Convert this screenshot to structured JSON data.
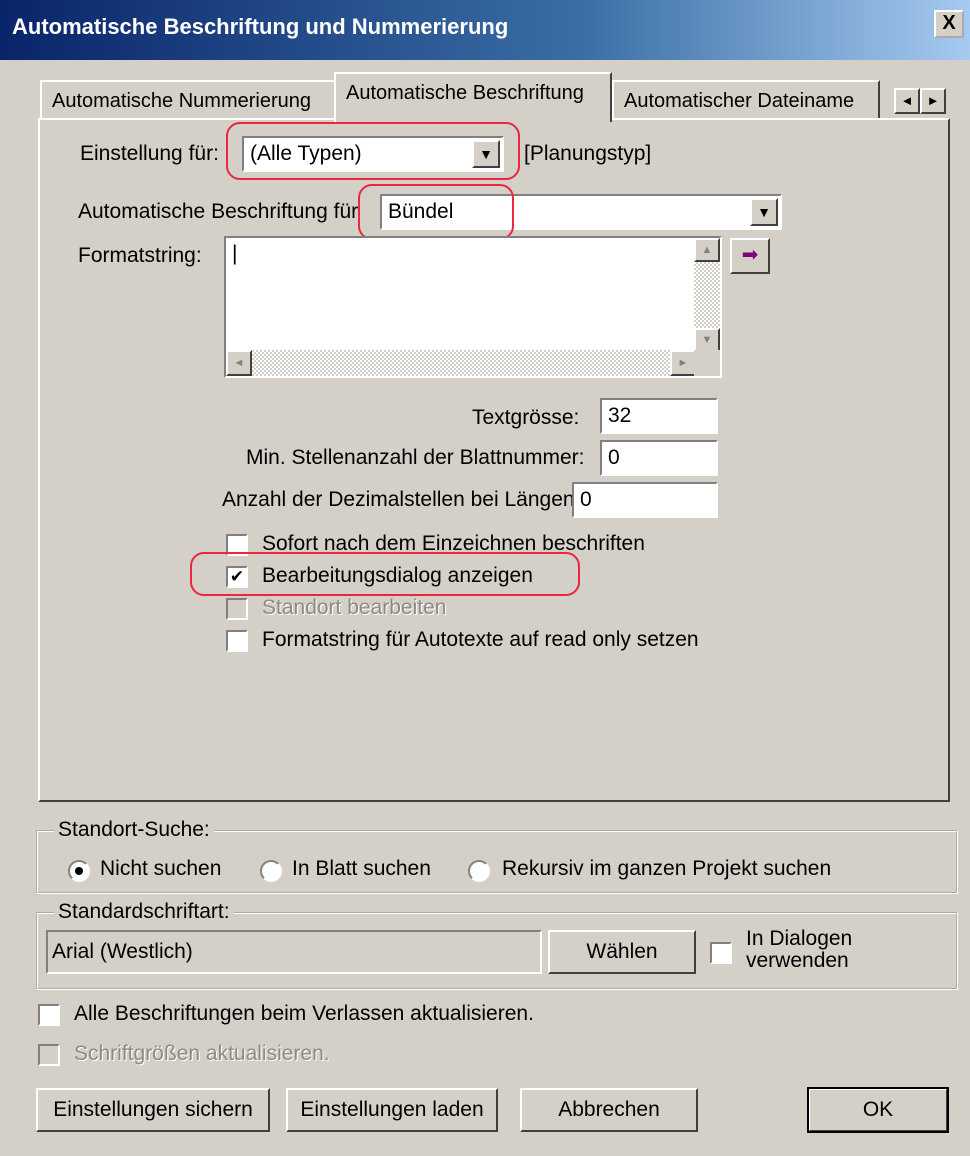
{
  "window": {
    "title": "Automatische Beschriftung und Nummerierung",
    "close_glyph": "X"
  },
  "tabs": [
    {
      "label": "Automatische Nummerierung"
    },
    {
      "label": "Automatische Beschriftung"
    },
    {
      "label": "Automatischer Dateiname"
    }
  ],
  "tab_scroll": {
    "left": "◄",
    "right": "►"
  },
  "panel": {
    "einstellung_label": "Einstellung für:",
    "einstellung_value": "(Alle Typen)",
    "planungstyp": "[Planungstyp]",
    "beschriftung_fuer_label": "Automatische Beschriftung für",
    "beschriftung_fuer_value": "Bündel",
    "formatstring_label": "Formatstring:",
    "formatstring_value": "",
    "arrow_glyph": "➡",
    "textgroesse_label": "Textgrösse:",
    "textgroesse_value": "32",
    "min_stellen_label": "Min. Stellenanzahl der Blattnummer:",
    "min_stellen_value": "0",
    "dezimal_label": "Anzahl der Dezimalstellen bei Längen:",
    "dezimal_value": "0",
    "checkboxes": [
      {
        "label": "Sofort nach dem Einzeichnen beschriften",
        "checked": false,
        "disabled": false
      },
      {
        "label": "Bearbeitungsdialog anzeigen",
        "checked": true,
        "disabled": false
      },
      {
        "label": "Standort bearbeiten",
        "checked": false,
        "disabled": true
      },
      {
        "label": "Formatstring für Autotexte auf read only setzen",
        "checked": false,
        "disabled": false
      }
    ],
    "check_glyph": "✔"
  },
  "standort_suche": {
    "legend": "Standort-Suche:",
    "options": [
      {
        "label": "Nicht suchen",
        "selected": true
      },
      {
        "label": "In Blatt suchen",
        "selected": false
      },
      {
        "label": "Rekursiv im ganzen Projekt suchen",
        "selected": false
      }
    ]
  },
  "standardschriftart": {
    "legend": "Standardschriftart:",
    "value": "Arial (Westlich)",
    "waehlen_button": "Wählen",
    "in_dialogen_line1": "In Dialogen",
    "in_dialogen_line2": "verwenden"
  },
  "bottom_checks": [
    {
      "label": "Alle Beschriftungen beim Verlassen aktualisieren.",
      "checked": false,
      "disabled": false
    },
    {
      "label": "Schriftgrößen aktualisieren.",
      "checked": false,
      "disabled": true
    }
  ],
  "buttons": {
    "sichern": "Einstellungen sichern",
    "laden": "Einstellungen laden",
    "abbrechen": "Abbrechen",
    "ok": "OK"
  },
  "colors": {
    "annotation": "#e8283c",
    "titlebar": "#0a246a",
    "face": "#d4d0c8",
    "arrow": "#800080"
  }
}
